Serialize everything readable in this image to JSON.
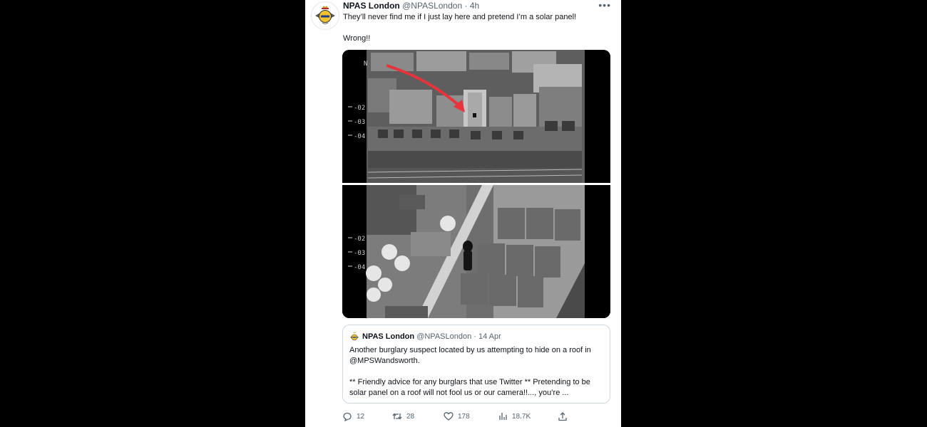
{
  "tweet": {
    "author_name": "NPAS London",
    "author_handle": "@NPASLondon",
    "separator": "·",
    "time": "4h",
    "text_line1": "They’ll never find me if I just lay here and pretend I’m a solar panel!",
    "text_line2": "Wrong!!",
    "more_icon": "more-dots-icon"
  },
  "media": {
    "overlay_top": [
      "-02",
      "-03",
      "-04"
    ],
    "overlay_bottom": [
      "-02",
      "-03",
      "-04"
    ],
    "overlay_corner": "N"
  },
  "quote": {
    "author_name": "NPAS London",
    "author_handle": "@NPASLondon",
    "separator": "·",
    "date": "14 Apr",
    "line1": "Another burglary suspect located by us attempting to hide on a roof in @MPSWandsworth.",
    "line2": "** Friendly advice for any burglars that use Twitter ** Pretending to be solar panel on a roof will not fool us or our camera!!..., you’re ..."
  },
  "actions": {
    "replies": "12",
    "retweets": "28",
    "likes": "178",
    "views": "18.7K"
  },
  "colors": {
    "background": "#000000",
    "card": "#ffffff",
    "text": "#0f1419",
    "secondary": "#536471",
    "arrow": "#e8333a",
    "badge_yellow": "#f2c230"
  }
}
